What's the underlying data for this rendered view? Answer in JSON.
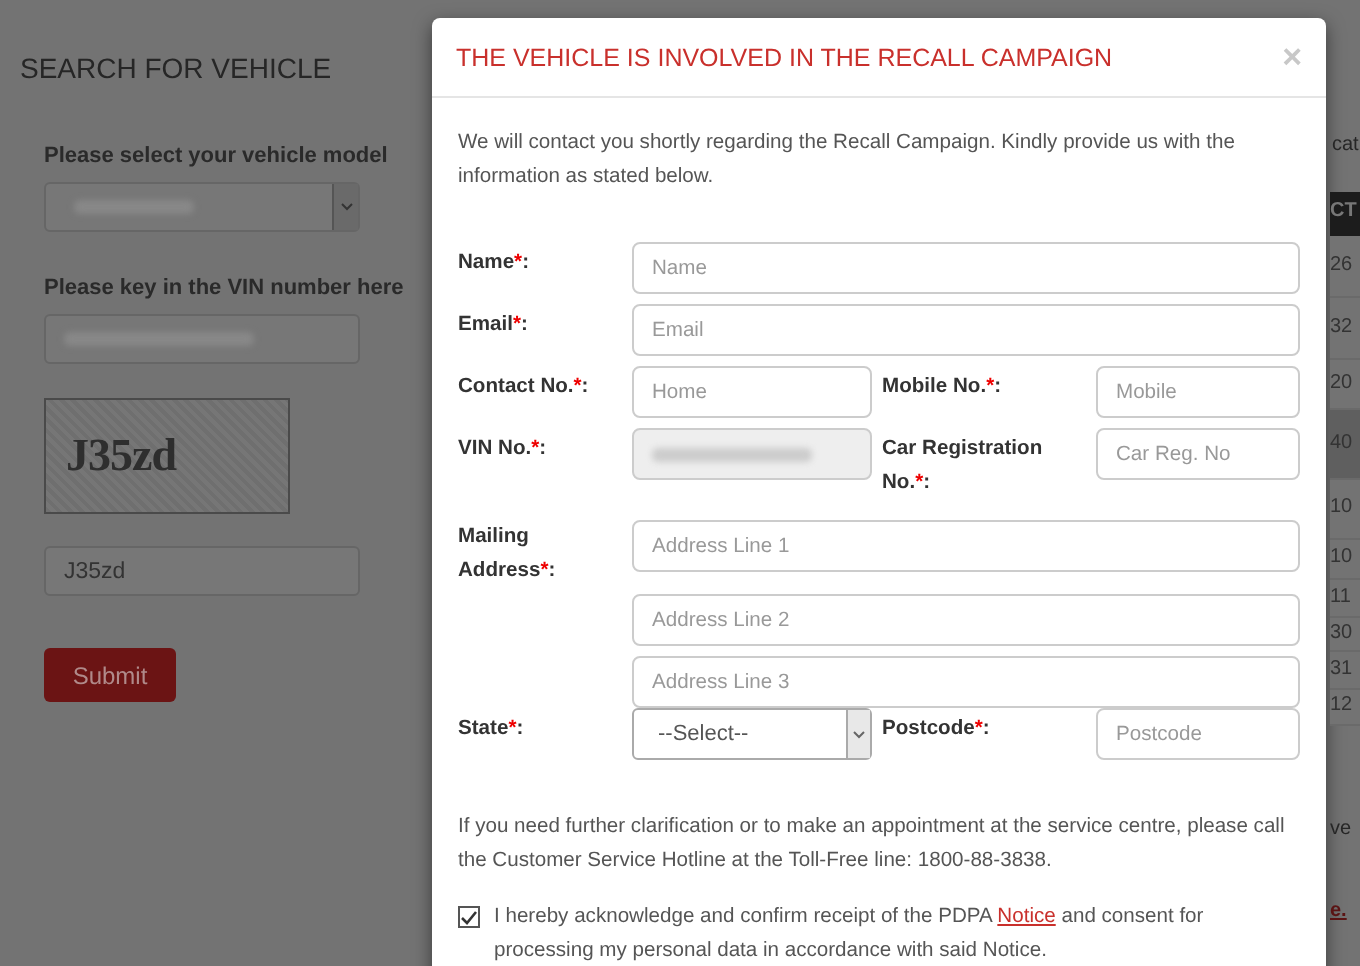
{
  "page": {
    "title": "SEARCH FOR VEHICLE",
    "model_label": "Please select your vehicle model",
    "vin_label": "Please key in the VIN number here",
    "captcha": "J35zd",
    "captcha_input": "J35zd",
    "submit": "Submit"
  },
  "background_table": {
    "heading": "cat",
    "header": "CT",
    "rows": [
      "26",
      "32",
      "20",
      "40",
      "10",
      "10",
      "11",
      "30",
      "31",
      "12"
    ],
    "note": "ve",
    "link": "e."
  },
  "modal": {
    "title": "THE VEHICLE IS INVOLVED IN THE RECALL CAMPAIGN",
    "close": "×",
    "intro": "We will contact you shortly regarding the Recall Campaign. Kindly provide us with the information as stated below.",
    "rows": [
      {
        "kind": "single",
        "cells": [
          {
            "label": "Name",
            "mark": "*",
            "colon": ":",
            "kind": "text",
            "placeholder": "Name"
          }
        ]
      },
      {
        "kind": "single",
        "cells": [
          {
            "label": "Email",
            "mark": "*",
            "colon": ":",
            "kind": "text",
            "placeholder": "Email"
          }
        ]
      },
      {
        "kind": "pair",
        "cells": [
          {
            "label": "Contact No.",
            "mark": "*",
            "colon": ":",
            "kind": "text",
            "placeholder": "Home"
          },
          {
            "label": "Mobile No.",
            "mark": "*",
            "colon": ":",
            "kind": "text",
            "placeholder": "Mobile"
          }
        ]
      },
      {
        "kind": "pair",
        "cells": [
          {
            "label": "VIN No.",
            "mark": "*",
            "colon": ":",
            "kind": "text",
            "disabled": true
          },
          {
            "label": "Car Registration No.",
            "mark": "*",
            "colon": ":",
            "kind": "text",
            "placeholder": "Car Reg. No"
          }
        ]
      },
      {
        "kind": "address",
        "cells": [
          {
            "label": "Mailing Address",
            "mark": "*",
            "colon": ":",
            "kind": "lines",
            "lines": [
              {
                "placeholder": "Address Line 1"
              },
              {
                "placeholder": "Address Line 2"
              },
              {
                "placeholder": "Address Line 3"
              }
            ]
          }
        ]
      },
      {
        "kind": "pair",
        "cells": [
          {
            "label": "State",
            "mark": "*",
            "colon": ":",
            "kind": "select",
            "value": "--Select--"
          },
          {
            "label": "Postcode",
            "mark": "*",
            "colon": ":",
            "kind": "text",
            "placeholder": "Postcode"
          }
        ]
      }
    ],
    "note": "If you need further clarification or to make an appointment at the service centre, please call the Customer Service Hotline at the Toll-Free line: 1800-88-3838.",
    "consent": {
      "checked": true,
      "text_before": "I hereby acknowledge and confirm receipt of the PDPA",
      "link": "Notice",
      "text_after": "and consent for processing my personal data in accordance with said Notice."
    }
  }
}
